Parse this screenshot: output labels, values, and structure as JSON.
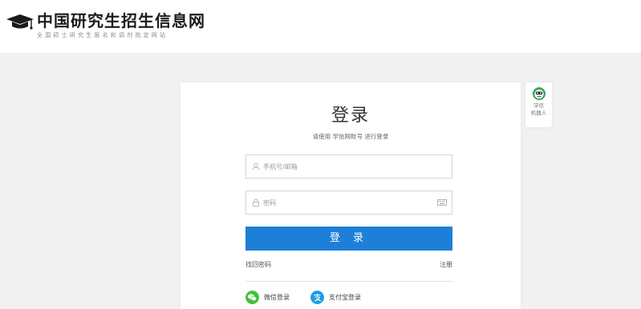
{
  "header": {
    "title": "中国研究生招生信息网",
    "subtitle": "全国硕士研究生报名和调剂指定网站"
  },
  "login": {
    "title": "登录",
    "subtitle": "请使用 学信网账号 进行登录",
    "username_placeholder": "手机号/邮箱",
    "password_placeholder": "密码",
    "submit_label": "登 录",
    "forgot_label": "找回密码",
    "register_label": "注册",
    "wechat_label": "微信登录",
    "alipay_label": "支付宝登录"
  },
  "robot": {
    "label_line1": "学信",
    "label_line2": "机器人"
  },
  "icons": {
    "logo": "graduation-cap-icon",
    "user": "user-icon",
    "lock": "lock-icon",
    "keyboard": "keyboard-icon",
    "wechat": "wechat-icon",
    "alipay": "alipay-icon",
    "robot": "robot-icon"
  },
  "colors": {
    "primary": "#1e7fd8",
    "wechat": "#3ec436",
    "alipay": "#1b9de3",
    "background": "#f1f1f1"
  }
}
